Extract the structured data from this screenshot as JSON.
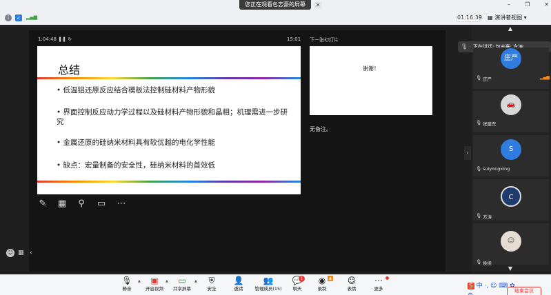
{
  "top": {
    "share_banner": "您正在观看包志豪的屏幕",
    "timer": "01:16:39",
    "presenter_view_label": "演讲者视图",
    "win_min": "–",
    "win_restore": "❐",
    "win_close": "✕"
  },
  "presenter": {
    "elapsed": "1:04:48",
    "clock": "15:01",
    "next_label": "下一张幻灯片",
    "notes": "无备注。",
    "slide": {
      "title": "总结",
      "bullets": [
        "低温铝还原反应结合模板法控制硅材料产物形貌",
        "界面控制反应动力学过程以及硅材料产物形貌和晶相；机理需进一步研究",
        "金属还原的硅纳米材料具有较优越的电化学性能",
        "缺点：宏量制备的安全性，硅纳米材料的首效低"
      ]
    },
    "next_slide_text": "谢谢！"
  },
  "speaking": "正在讲话: 包志豪; 方涛;",
  "participants": [
    {
      "name": "庄严",
      "avatar_text": "庄严",
      "color": "#2f7de1"
    },
    {
      "name": "张建东",
      "avatar_text": "",
      "color": "#d8d8d8"
    },
    {
      "name": "suiyongxing",
      "avatar_text": "S",
      "color": "#2f7de1"
    },
    {
      "name": "方涛",
      "avatar_text": "",
      "color": "#1d3b6e"
    },
    {
      "name": "侯侯",
      "avatar_text": "",
      "color": "#e6ddd2"
    }
  ],
  "toolbar": {
    "mute": "静音",
    "stop_video": "开启视频",
    "share": "共享屏幕",
    "security": "安全",
    "invite": "邀请",
    "members": "管理成员(15)",
    "chat": "聊天",
    "chat_badge": "1",
    "record": "录制",
    "reactions": "表情",
    "more": "更多",
    "end": "结束会议"
  },
  "ime": "中 ·, ☺ ⌨ ✿ ⚙"
}
